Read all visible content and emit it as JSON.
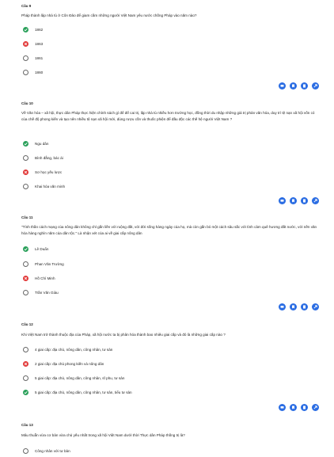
{
  "questions": [
    {
      "title": "Câu 9",
      "text": "Pháp thành lập nhà tù ở Côn Đảo để giam cầm những người Việt Nam yêu nước chống Pháp vào năm nào?",
      "options": [
        {
          "label": "1862",
          "state": "correct"
        },
        {
          "label": "1863",
          "state": "wrong"
        },
        {
          "label": "1861",
          "state": "empty"
        },
        {
          "label": "1860",
          "state": "empty"
        }
      ]
    },
    {
      "title": "Câu 10",
      "text": "Về Văn hóa – xã hội, thực dân Pháp thực hiện chính sách gì để để cai trị, lập nhà tù nhiều hơn trường học, đồng thời du nhập những giá trị phản văn hóa, duy trì tệ nạn xã hội vốn có của chế độ phong kiến và tạo nên nhiều tệ nạn xã hội mới, dùng rượu cồn và thuốc phiện để đầu độc các thế hệ người Việt Nam ?",
      "options": [
        {
          "label": "Ngu dân",
          "state": "correct"
        },
        {
          "label": "Bình đẳng, bác ái",
          "state": "empty"
        },
        {
          "label": "Sơ học yếu lược",
          "state": "wrong"
        },
        {
          "label": "Khai hóa văn minh",
          "state": "empty"
        }
      ]
    },
    {
      "title": "Câu 11",
      "text": "\"Tính thần cách mạng của nông dân không chỉ gắn liền với ruộng đất, với đời sống hàng ngày của họ, mà còn gắn bó một cách sâu sắc với tình cảm quê hương đất nước, với nền văn hóa hàng nghìn năm của dân tộc.\" Là nhận xét của ai về giai cấp nông dân",
      "options": [
        {
          "label": "Lê Duẩn",
          "state": "correct"
        },
        {
          "label": "Phan Văn Trường",
          "state": "empty"
        },
        {
          "label": "Hồ Chí Minh",
          "state": "wrong"
        },
        {
          "label": "Trần Văn Giàu",
          "state": "empty"
        }
      ]
    },
    {
      "title": "Câu 12",
      "text": "Khi Việt Nam trở thành thuộc địa của Pháp, xã hội nước ta bị phân hóa thành bao nhiêu giai cấp và đó là những giai cấp nào ?",
      "options": [
        {
          "label": "4 giai cấp: địa chủ, nông dân, công nhân, tư sản",
          "state": "empty"
        },
        {
          "label": "2 giai cấp: địa chủ phong kiến và nông dân",
          "state": "wrong"
        },
        {
          "label": "5 giai cấp: địa chủ, nông dân, công nhân, sĩ phu, tư sản",
          "state": "empty"
        },
        {
          "label": "5 giai cấp: địa chủ, nông dân, công nhân, tư sản, tiểu tư sản",
          "state": "correct"
        }
      ]
    },
    {
      "title": "Câu 13",
      "text": "Mâu thuẫn vừa cơ bản vừa chủ yếu nhất trong xã hội Việt Nam dưới thời Thực dân Pháp thống trị là?",
      "options": [
        {
          "label": "Công nhân với tư bản",
          "state": "empty"
        }
      ]
    }
  ],
  "action_icons": [
    "comment-icon",
    "bookmark-icon",
    "note-icon",
    "share-icon"
  ],
  "colors": {
    "correct": "#2aa05a",
    "wrong": "#e23b3b",
    "accent": "#2b6de3"
  }
}
